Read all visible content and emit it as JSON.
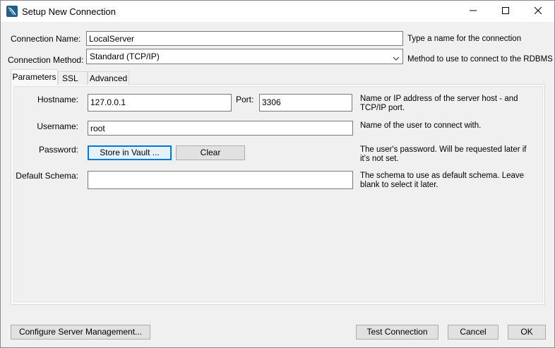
{
  "window": {
    "title": "Setup New Connection",
    "icon": "mysql-workbench-icon",
    "controls": [
      "minimize-icon",
      "maximize-icon",
      "close-icon"
    ]
  },
  "connection": {
    "name_label": "Connection Name:",
    "name_value": "LocalServer",
    "name_hint": "Type a name for the connection",
    "method_label": "Connection Method:",
    "method_value": "Standard (TCP/IP)",
    "method_hint": "Method to use to connect to the RDBMS"
  },
  "tabs": [
    {
      "label": "Parameters",
      "active": true
    },
    {
      "label": "SSL",
      "active": false
    },
    {
      "label": "Advanced",
      "active": false
    }
  ],
  "params": {
    "hostname_label": "Hostname:",
    "hostname_value": "127.0.0.1",
    "port_label": "Port:",
    "port_value": "3306",
    "hostname_hint": "Name or IP address of the server host - and TCP/IP port.",
    "username_label": "Username:",
    "username_value": "root",
    "username_hint": "Name of the user to connect with.",
    "password_label": "Password:",
    "store_vault_label": "Store in Vault ...",
    "clear_label": "Clear",
    "password_hint": "The user's password. Will be requested later if it's not set.",
    "schema_label": "Default Schema:",
    "schema_value": "",
    "schema_hint": "The schema to use as default schema. Leave blank to select it later."
  },
  "footer": {
    "configure_label": "Configure Server Management...",
    "test_label": "Test Connection",
    "cancel_label": "Cancel",
    "ok_label": "OK"
  },
  "colors": {
    "window_bg": "#f0f0f0",
    "panel_bg": "#f9f9f9",
    "focus_accent": "#0078d7"
  }
}
